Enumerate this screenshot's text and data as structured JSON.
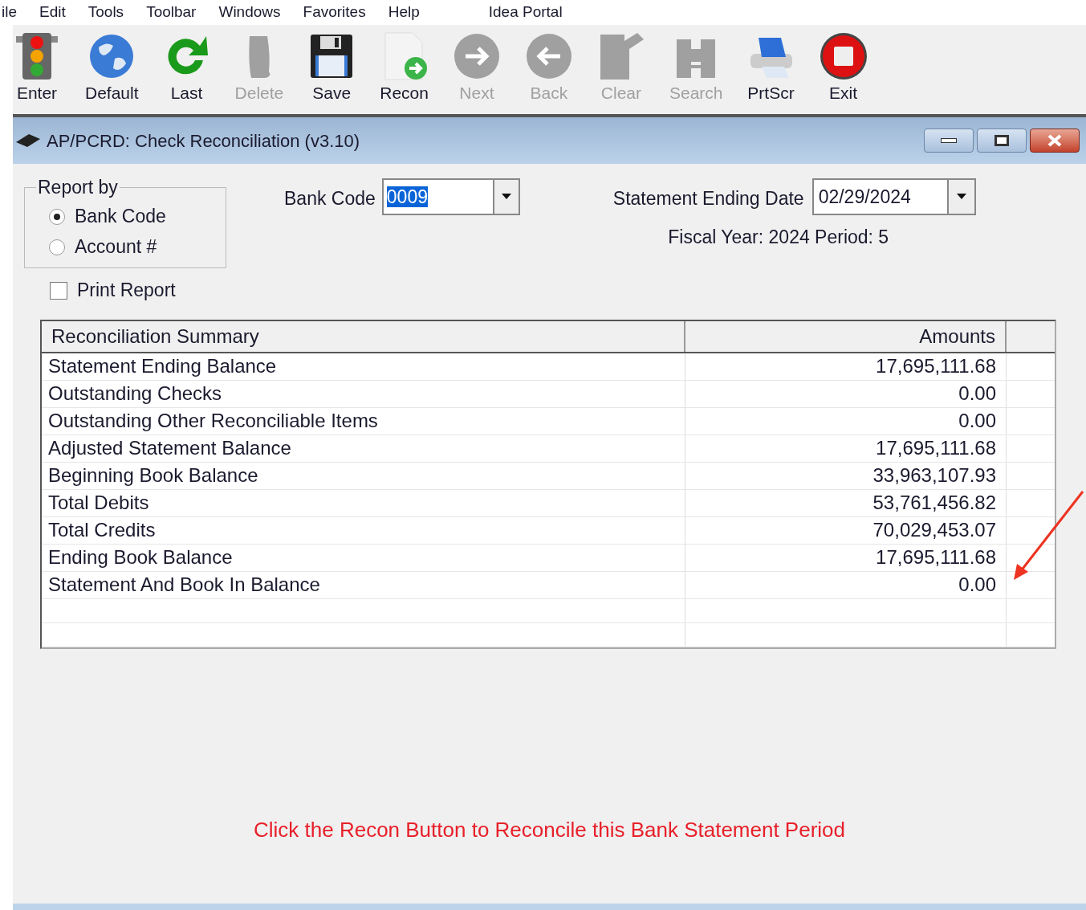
{
  "menu": [
    "ile",
    "Edit",
    "Tools",
    "Toolbar",
    "Windows",
    "Favorites",
    "Help",
    "Idea Portal"
  ],
  "toolbar": [
    {
      "label": "Enter",
      "kind": "traffic",
      "disabled": false
    },
    {
      "label": "Default",
      "kind": "globe",
      "disabled": false
    },
    {
      "label": "Last",
      "kind": "refresh",
      "disabled": false
    },
    {
      "label": "Delete",
      "kind": "delete",
      "disabled": true
    },
    {
      "label": "Save",
      "kind": "save",
      "disabled": false
    },
    {
      "label": "Recon",
      "kind": "recon",
      "disabled": false
    },
    {
      "label": "Next",
      "kind": "next",
      "disabled": true
    },
    {
      "label": "Back",
      "kind": "back",
      "disabled": true
    },
    {
      "label": "Clear",
      "kind": "clear",
      "disabled": true
    },
    {
      "label": "Search",
      "kind": "search",
      "disabled": true
    },
    {
      "label": "PrtScr",
      "kind": "print",
      "disabled": false
    },
    {
      "label": "Exit",
      "kind": "exit",
      "disabled": false
    }
  ],
  "window": {
    "title": "AP/PCRD: Check Reconciliation (v3.10)"
  },
  "report_by": {
    "legend": "Report by",
    "options": [
      {
        "label": "Bank Code",
        "selected": true
      },
      {
        "label": "Account #",
        "selected": false
      }
    ]
  },
  "print_report": {
    "label": "Print Report",
    "checked": false
  },
  "bank_code": {
    "label": "Bank Code",
    "value": "0009"
  },
  "statement_date": {
    "label": "Statement Ending Date",
    "value": "02/29/2024"
  },
  "fiscal": "Fiscal Year: 2024 Period: 5",
  "table": {
    "columns": [
      "Reconciliation Summary",
      "Amounts"
    ],
    "rows": [
      [
        "Statement Ending Balance",
        "17,695,111.68"
      ],
      [
        "Outstanding Checks",
        "0.00"
      ],
      [
        "Outstanding Other Reconciliable Items",
        "0.00"
      ],
      [
        "Adjusted Statement Balance",
        "17,695,111.68"
      ],
      [
        "Beginning Book Balance",
        "33,963,107.93"
      ],
      [
        "Total Debits",
        "53,761,456.82"
      ],
      [
        "Total Credits",
        "70,029,453.07"
      ],
      [
        "Ending Book Balance",
        "17,695,111.68"
      ],
      [
        "Statement And Book In Balance",
        "0.00"
      ]
    ]
  },
  "message": "Click the Recon Button to Reconcile this Bank Statement Period"
}
